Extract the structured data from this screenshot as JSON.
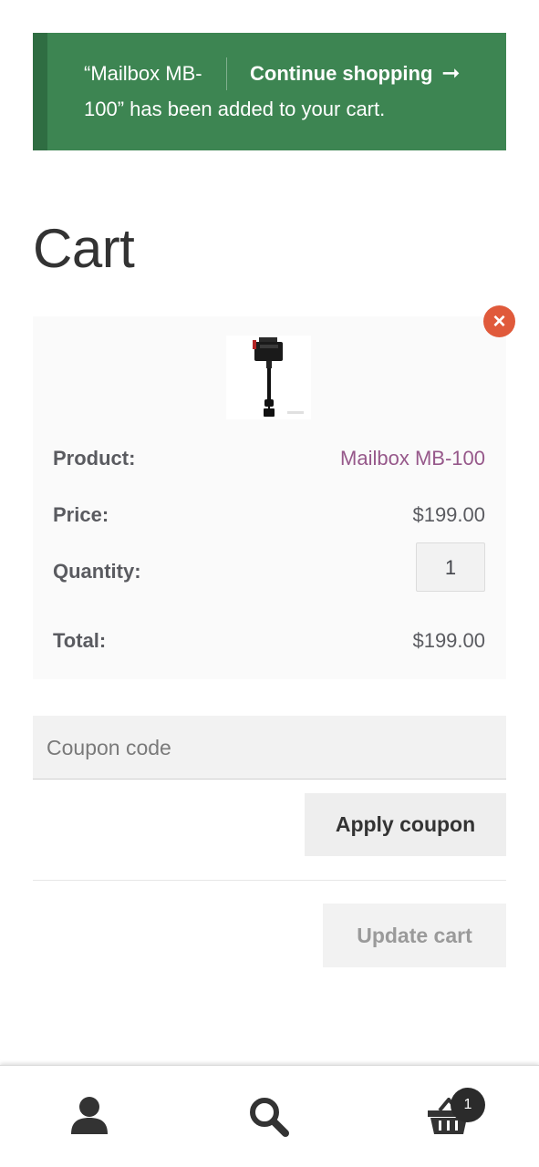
{
  "notice": {
    "message_line1": "“Mailbox MB-",
    "message_line2": "100” has been added to your cart.",
    "continue_label": "Continue shopping",
    "arrow": "➞"
  },
  "page": {
    "title": "Cart"
  },
  "cart": {
    "remove_icon": "×",
    "product_label": "Product:",
    "product_name": "Mailbox MB-100",
    "price_label": "Price:",
    "price": "$199.00",
    "quantity_label": "Quantity:",
    "quantity": "1",
    "total_label": "Total:",
    "total": "$199.00"
  },
  "coupon": {
    "placeholder": "Coupon code",
    "apply_label": "Apply coupon"
  },
  "update_label": "Update cart",
  "footer": {
    "icons": [
      "account-icon",
      "search-icon",
      "basket-icon"
    ],
    "cart_count": "1"
  },
  "colors": {
    "notice_bg": "#3d8552",
    "link": "#96588a",
    "remove": "#e05a3b"
  }
}
